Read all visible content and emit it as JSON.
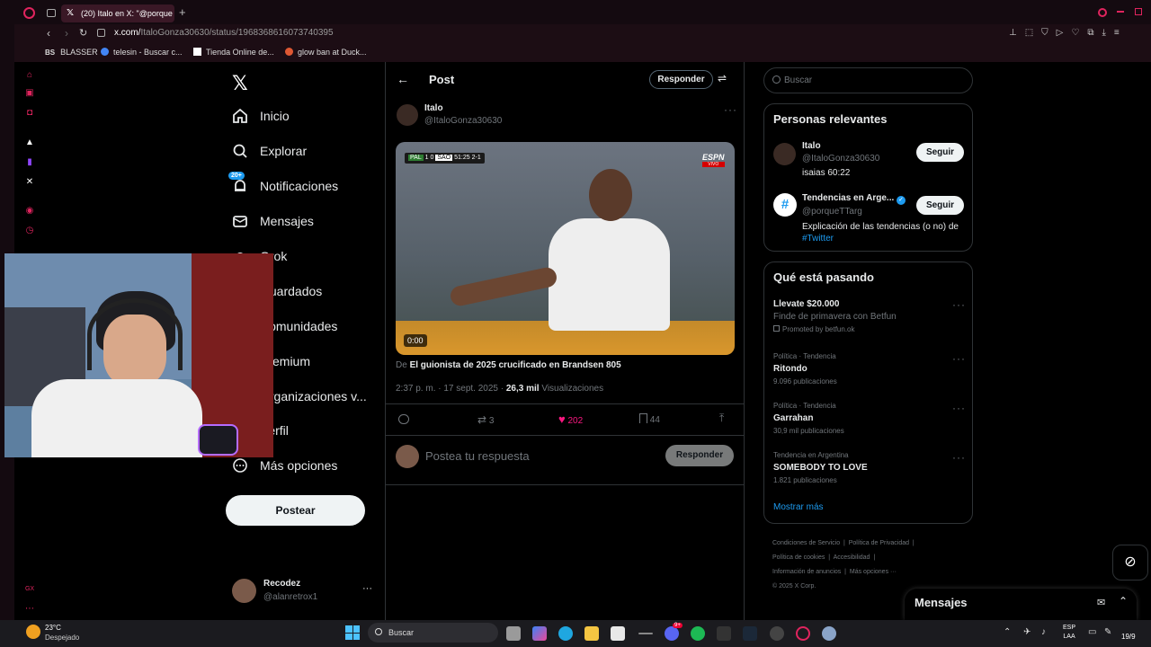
{
  "browser": {
    "tab_title": "(20) Italo en X: \"@porque",
    "url_prefix": "x.com/",
    "url_rest": "ItaloGonza30630/status/1968368616073740395",
    "bookmarks": [
      "BLASSER",
      "telesin - Buscar c...",
      "Tienda Online de...",
      "glow ban at Duck..."
    ]
  },
  "nav": {
    "items": [
      "Inicio",
      "Explorar",
      "Notificaciones",
      "Mensajes",
      "Grok",
      "Guardados",
      "Comunidades",
      "Premium",
      "Organizaciones v...",
      "Perfil",
      "Más opciones"
    ],
    "notif_badge": "20+",
    "post_button": "Postear",
    "account_name": "Recodez",
    "account_handle": "@alanretrox1"
  },
  "post": {
    "header": "Post",
    "reply_top": "Responder",
    "author_name": "Italo",
    "author_handle": "@ItaloGonza30630",
    "video_time": "0:00",
    "video_score": {
      "team1": "PAL",
      "s1": "1",
      "s2": "0",
      "team2": "SAO",
      "clock": "51:25",
      "agg": "2-1"
    },
    "video_brand": "ESPN",
    "video_brand_sub": "VIVO",
    "source_prefix": "De",
    "source_title": "El guionista de 2025 crucificado en Brandsen 805",
    "timestamp": "2:37 p. m. · 17 sept. 2025 ·",
    "views_count": "26,3 mil",
    "views_label": "Visualizaciones",
    "reposts": "3",
    "likes": "202",
    "bookmarks": "44",
    "reply_placeholder": "Postea tu respuesta",
    "reply_button": "Responder"
  },
  "search": {
    "placeholder": "Buscar"
  },
  "relevant": {
    "title": "Personas relevantes",
    "people": [
      {
        "name": "Italo",
        "handle": "@ItaloGonza30630",
        "bio": "isaias 60:22",
        "follow": "Seguir"
      },
      {
        "name": "Tendencias en Arge...",
        "handle": "@porqueTTarg",
        "bio": "Explicación de las tendencias (o no) de",
        "bio_link": "#Twitter",
        "follow": "Seguir"
      }
    ]
  },
  "trends": {
    "title": "Qué está pasando",
    "promo_title": "Llevate $20.000",
    "promo_desc": "Finde de primavera con Betfun",
    "promo_by": "Promoted by betfun.ok",
    "items": [
      {
        "meta": "Política · Tendencia",
        "name": "Ritondo",
        "count": "9.096 publicaciones"
      },
      {
        "meta": "Política · Tendencia",
        "name": "Garrahan",
        "count": "30,9 mil publicaciones"
      },
      {
        "meta": "Tendencia en Argentina",
        "name": "SOMEBODY TO LOVE",
        "count": "1.821 publicaciones"
      }
    ],
    "show_more": "Mostrar más"
  },
  "footer": {
    "links": [
      "Condiciones de Servicio",
      "Política de Privacidad",
      "Política de cookies",
      "Accesibilidad",
      "Información de anuncios",
      "Más opciones ···"
    ],
    "copyright": "© 2025 X Corp."
  },
  "messages_drawer": {
    "title": "Mensajes"
  },
  "taskbar": {
    "weather_temp": "23°C",
    "weather_desc": "Despejado",
    "search_placeholder": "Buscar",
    "lang1": "ESP",
    "lang2": "LAA",
    "date": "19/9",
    "discord_badge": "9+"
  },
  "colors": {
    "like_pink": "#f91880",
    "x_blue": "#1d9bf0",
    "opera_red": "#e0245e"
  }
}
